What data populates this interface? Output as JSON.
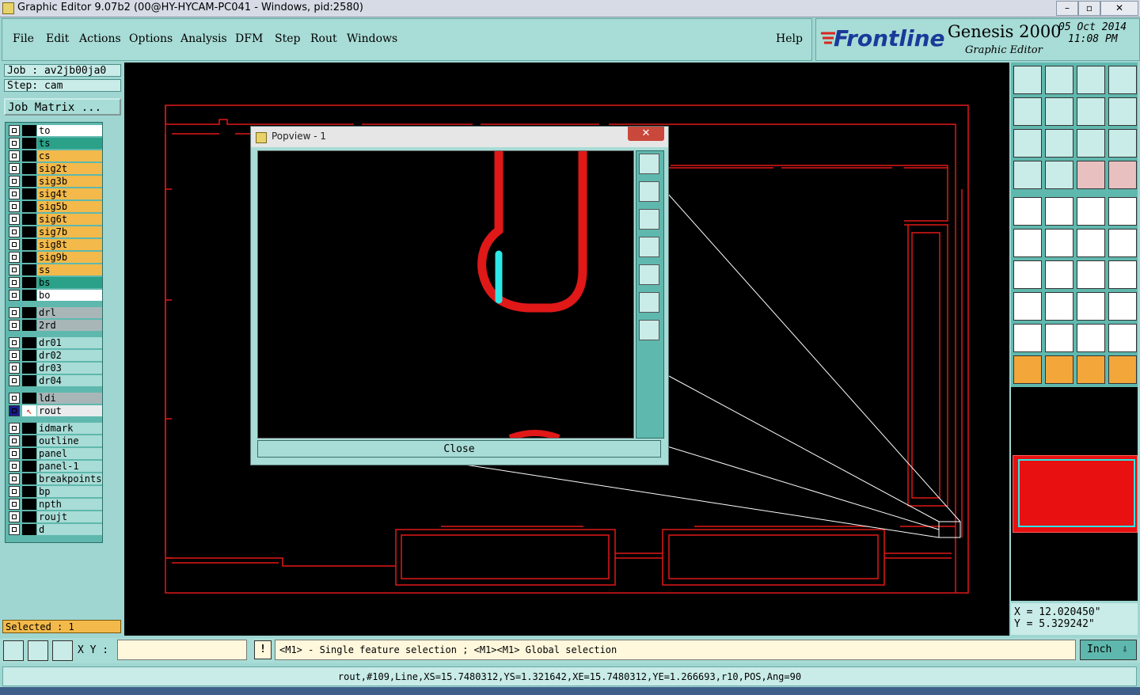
{
  "window": {
    "title": "Graphic Editor 9.07b2 (00@HY-HYCAM-PC041 - Windows, pid:2580)",
    "controls": [
      "–",
      "▫",
      "✕"
    ]
  },
  "menu": [
    "File",
    "Edit",
    "Actions",
    "Options",
    "Analysis",
    "DFM",
    "Step",
    "Rout",
    "Windows"
  ],
  "help": "Help",
  "brand": {
    "logo": "Frontline",
    "product": "Genesis 2000",
    "subtitle": "Graphic Editor",
    "date": "05 Oct 2014",
    "time": "11:08 PM"
  },
  "job": {
    "job_line": "Job : av2jb00ja0",
    "step_line": "Step: cam",
    "matrix_button": "Job Matrix ..."
  },
  "layers": [
    {
      "name": "to",
      "color": "#ffffff"
    },
    {
      "name": "ts",
      "color": "#2aa188"
    },
    {
      "name": "cs",
      "color": "#f3b94a"
    },
    {
      "name": "sig2t",
      "color": "#f3b94a"
    },
    {
      "name": "sig3b",
      "color": "#f3b94a"
    },
    {
      "name": "sig4t",
      "color": "#f3b94a"
    },
    {
      "name": "sig5b",
      "color": "#f3b94a"
    },
    {
      "name": "sig6t",
      "color": "#f3b94a"
    },
    {
      "name": "sig7b",
      "color": "#f3b94a"
    },
    {
      "name": "sig8t",
      "color": "#f3b94a"
    },
    {
      "name": "sig9b",
      "color": "#f3b94a"
    },
    {
      "name": "ss",
      "color": "#f3b94a"
    },
    {
      "name": "bs",
      "color": "#2aa188"
    },
    {
      "name": "bo",
      "color": "#ffffff"
    },
    {
      "name": "drl",
      "color": "#a9b6b8"
    },
    {
      "name": "2rd",
      "color": "#a9b6b8"
    },
    {
      "name": "dr01",
      "color": "#a8dcd6"
    },
    {
      "name": "dr02",
      "color": "#a8dcd6"
    },
    {
      "name": "dr03",
      "color": "#a8dcd6"
    },
    {
      "name": "dr04",
      "color": "#a8dcd6"
    },
    {
      "name": "ldi",
      "color": "#a9b6b8"
    },
    {
      "name": "rout",
      "color": "#e8ecec"
    },
    {
      "name": "idmark",
      "color": "#a8dcd6"
    },
    {
      "name": "outline",
      "color": "#a8dcd6"
    },
    {
      "name": "panel",
      "color": "#a8dcd6"
    },
    {
      "name": "panel-1",
      "color": "#a8dcd6"
    },
    {
      "name": "breakpoints",
      "color": "#a8dcd6"
    },
    {
      "name": "bp",
      "color": "#a8dcd6"
    },
    {
      "name": "npth",
      "color": "#a8dcd6"
    },
    {
      "name": "roujt",
      "color": "#a8dcd6"
    },
    {
      "name": "d",
      "color": "#a8dcd6"
    }
  ],
  "selected": "Selected : 1",
  "popview": {
    "title": "Popview - 1",
    "close_button": "Close",
    "close_x": "✕"
  },
  "coords": {
    "x": "X = 12.020450\"",
    "y": "Y = 5.329242\""
  },
  "bottom": {
    "xy_label": "X Y :",
    "xy_value": "",
    "exclaim": "!",
    "message": "<M1> - Single feature selection ; <M1><M1> Global selection",
    "unit": "Inch"
  },
  "status": "rout,#109,Line,XS=15.7480312,YS=1.321642,XE=15.7480312,YE=1.266693,r10,POS,Ang=90",
  "colors": {
    "rout_line": "#e01818",
    "highlight": "#2ee6e6",
    "panel": "#a8dcd6",
    "tool_frame": "#5fb8ae"
  }
}
